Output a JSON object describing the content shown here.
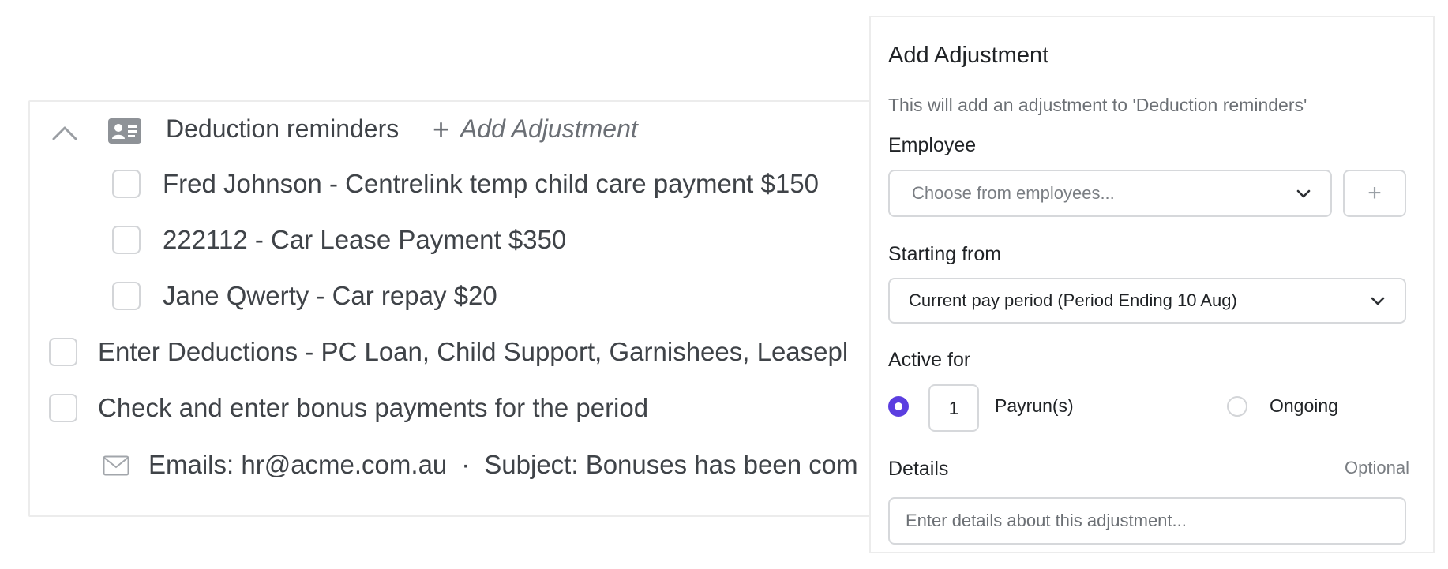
{
  "checklist": {
    "group_title": "Deduction reminders",
    "add_adjustment_plus": "+",
    "add_adjustment_label": "Add Adjustment",
    "sub_items": [
      {
        "label": "Fred Johnson - Centrelink temp child care payment $150"
      },
      {
        "label": "222112 - Car Lease Payment $350"
      },
      {
        "label": "Jane Qwerty - Car repay $20"
      }
    ],
    "items": [
      {
        "label": "Enter Deductions - PC Loan, Child Support, Garnishees, Leasepl"
      },
      {
        "label": "Check and enter bonus payments for the period"
      }
    ],
    "email_line": {
      "emails": "Emails: hr@acme.com.au",
      "separator": "·",
      "subject": "Subject: Bonuses has been com"
    }
  },
  "panel": {
    "title": "Add Adjustment",
    "subtitle": "This will add an adjustment to 'Deduction reminders'",
    "employee_label": "Employee",
    "employee_placeholder": "Choose from employees...",
    "add_employee_button": "+",
    "starting_from_label": "Starting from",
    "starting_from_value": "Current pay period (Period Ending 10 Aug)",
    "active_for_label": "Active for",
    "payrun_count": "1",
    "payrun_label": "Payrun(s)",
    "ongoing_label": "Ongoing",
    "details_label": "Details",
    "details_optional": "Optional",
    "details_placeholder": "Enter details about this adjustment..."
  },
  "colors": {
    "accent": "#5b3ee0",
    "text": "#3f4348",
    "border": "#d6d8db"
  }
}
